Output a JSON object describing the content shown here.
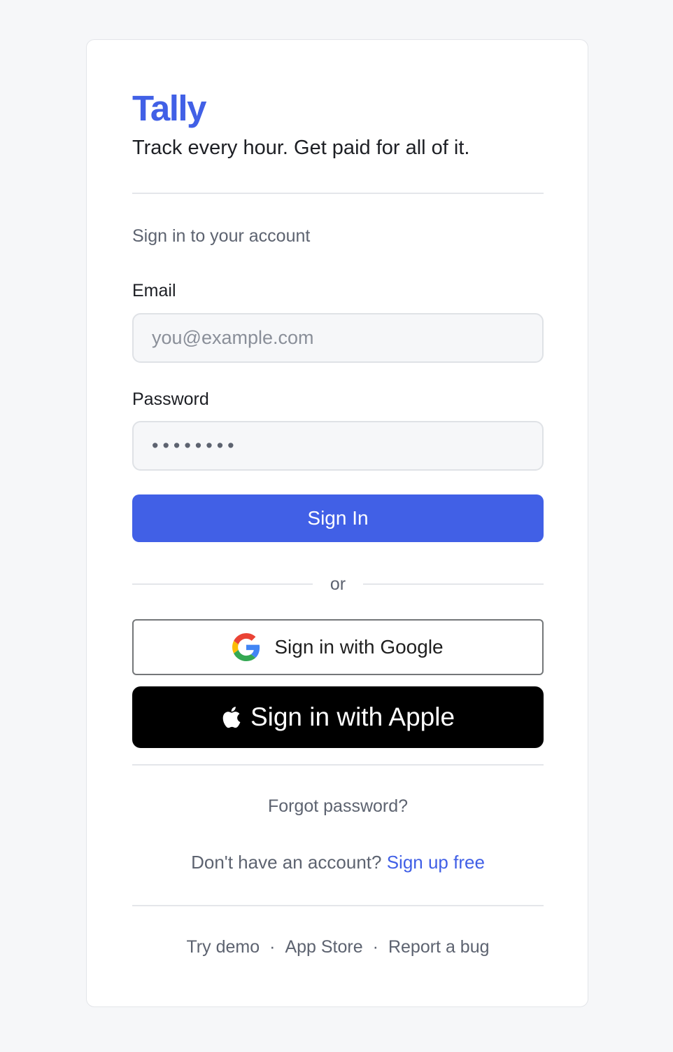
{
  "brand": {
    "name": "Tally",
    "tagline": "Track every hour. Get paid for all of it.",
    "accent_color": "#4160e6"
  },
  "login": {
    "subtitle": "Sign in to your account",
    "email": {
      "label": "Email",
      "placeholder": "you@example.com",
      "value": ""
    },
    "password": {
      "label": "Password",
      "masked_value": "••••••••"
    },
    "submit_label": "Sign In",
    "divider_text": "or",
    "google_button": {
      "label": "Sign in with Google",
      "icon": "google-icon"
    },
    "apple_button": {
      "label": "Sign in with Apple",
      "icon": "apple-icon"
    },
    "forgot_password": "Forgot password?",
    "signup_prompt": "Don't have an account?",
    "signup_link": "Sign up free"
  },
  "footer": {
    "links": [
      "Try demo",
      "App Store",
      "Report a bug"
    ],
    "separator": "·"
  }
}
